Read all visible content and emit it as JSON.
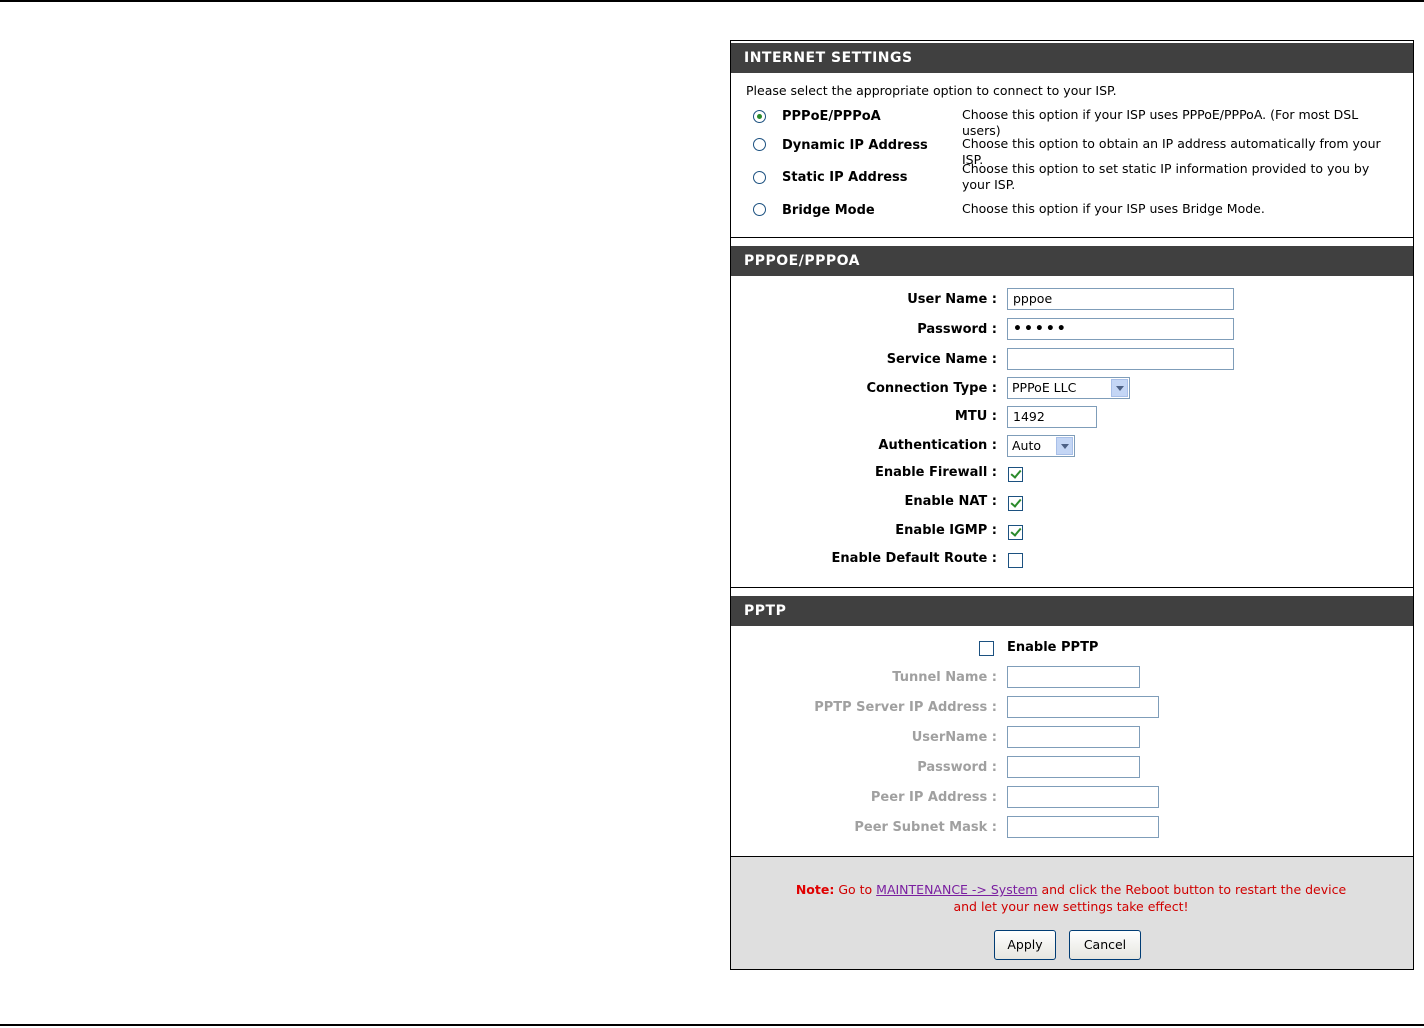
{
  "internet_settings": {
    "header": "INTERNET SETTINGS",
    "intro": "Please select the appropriate option to connect to your ISP.",
    "options": [
      {
        "label": "PPPoE/PPPoA",
        "desc": "Choose this option if your ISP uses PPPoE/PPPoA. (For most DSL users)",
        "selected": true
      },
      {
        "label": "Dynamic IP Address",
        "desc": "Choose this option to obtain an IP address automatically from your ISP.",
        "selected": false
      },
      {
        "label": "Static IP Address",
        "desc": "Choose this option to set static IP information provided to you by your ISP.",
        "selected": false
      },
      {
        "label": "Bridge Mode",
        "desc": "Choose this option if your ISP uses Bridge Mode.",
        "selected": false
      }
    ]
  },
  "pppoe": {
    "header": "PPPOE/PPPOA",
    "user_name_label": "User Name :",
    "user_name_value": "pppoe",
    "password_label": "Password :",
    "password_value": "•••••",
    "service_name_label": "Service Name :",
    "service_name_value": "",
    "connection_type_label": "Connection Type :",
    "connection_type_value": "PPPoE LLC",
    "mtu_label": "MTU :",
    "mtu_value": "1492",
    "auth_label": "Authentication :",
    "auth_value": "Auto",
    "firewall_label": "Enable Firewall :",
    "firewall_checked": true,
    "nat_label": "Enable NAT :",
    "nat_checked": true,
    "igmp_label": "Enable IGMP :",
    "igmp_checked": true,
    "default_route_label": "Enable Default Route :",
    "default_route_checked": false
  },
  "pptp": {
    "header": "PPTP",
    "enable_label": "Enable PPTP",
    "enable_checked": false,
    "tunnel_name_label": "Tunnel Name :",
    "server_ip_label": "PPTP Server IP Address :",
    "username_label": "UserName :",
    "password_label": "Password :",
    "peer_ip_label": "Peer IP Address :",
    "peer_mask_label": "Peer Subnet Mask :"
  },
  "footer": {
    "note_prefix": "Note:",
    "note_go": " Go to ",
    "note_link": "MAINTENANCE -> System",
    "note_rest": " and click the Reboot button to restart the device",
    "note_line2": "and let your new settings take effect!",
    "apply_label": "Apply",
    "cancel_label": "Cancel"
  },
  "colors": {
    "header_bg": "#404040",
    "footer_bg": "#dfdfdf",
    "note_red": "#d00000",
    "link_purple": "#7a1fa0"
  }
}
